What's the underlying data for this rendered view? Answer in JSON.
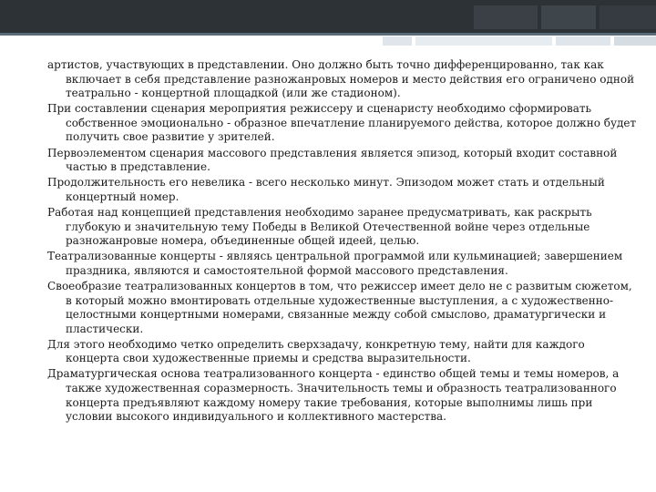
{
  "paragraphs": [
    "артистов, участвующих в представлении. Оно должно быть точно дифференцированно, так как включает в себя представление разножанровых номеров и место действия его ограничено одной театрально - концертной площадкой (или же стадионом).",
    "При составлении сценария мероприятия режиссеру и сценаристу необходимо сформировать собственное эмоционально - образное впечатление планируемого действа, которое должно будет получить свое развитие у зрителей.",
    "Первоэлементом сценария массового представления является эпизод, который входит составной частью в представление.",
    "Продолжительность его невелика - всего несколько минут. Эпизодом может стать и отдельный концертный номер.",
    "Работая над концепцией представления необходимо заранее предусматривать, как раскрыть глубокую и значительную тему Победы в Великой Отечественной войне через отдельные разножанровые номера, объединенные общей идеей, целью.",
    "Театрализованные концерты - являясь центральной программой или кульминацией; завершением праздника, являются и самостоятельной формой массового представления.",
    "Своеобразие театрализованных концертов в том, что режиссер имеет дело не с развитым сюжетом, в который можно вмонтировать отдельные художественные выступления, а с художественно-целостными концертными номерами, связанные между собой смыслово, драматургически и пластически.",
    "Для этого необходимо четко определить сверхзадачу, конкретную тему, найти для каждого концерта свои художественные приемы и средства выразительности.",
    "Драматургическая основа театрализованного концерта - единство общей темы и темы номеров, а также художественная соразмерность. Значительность темы и образность театрализованного концерта предъявляют каждому номеру такие требования, которые выполнимы лишь при условии высокого индивидуального и коллективного мастерства."
  ]
}
